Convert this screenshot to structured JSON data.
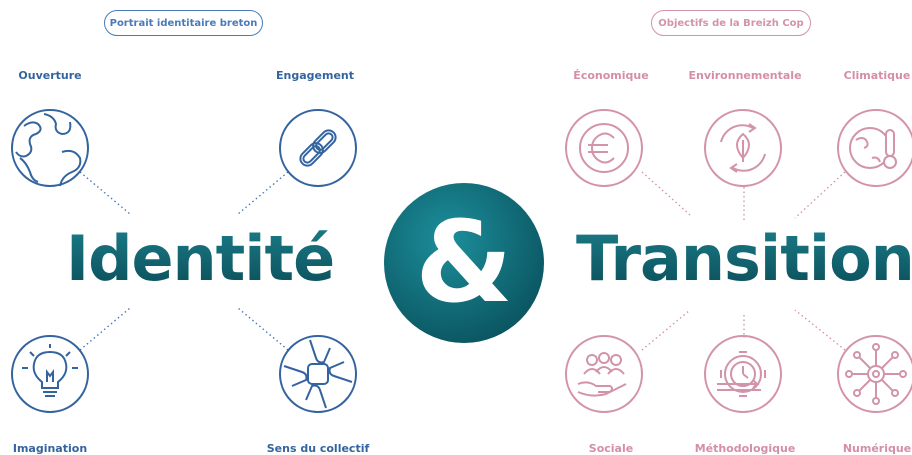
{
  "left_section": {
    "pill": "Portrait identitaire breton",
    "title": "Identité",
    "items": [
      {
        "label": "Ouverture",
        "icon": "globe-icon"
      },
      {
        "label": "Engagement",
        "icon": "chain-link-icon"
      },
      {
        "label": "Imagination",
        "icon": "lightbulb-icon"
      },
      {
        "label": "Sens du collectif",
        "icon": "joined-hands-icon"
      }
    ]
  },
  "center": {
    "symbol": "&"
  },
  "right_section": {
    "pill": "Objectifs de la Breizh Cop",
    "title": "Transitions",
    "items": [
      {
        "label": "Économique",
        "icon": "euro-icon"
      },
      {
        "label": "Environnementale",
        "icon": "leaf-cycle-icon"
      },
      {
        "label": "Climatique",
        "icon": "globe-thermometer-icon"
      },
      {
        "label": "Sociale",
        "icon": "people-hand-icon"
      },
      {
        "label": "Méthodologique",
        "icon": "gear-clock-icon"
      },
      {
        "label": "Numérique",
        "icon": "network-icon"
      }
    ]
  },
  "colors": {
    "blue": "#34649f",
    "pink": "#d48ea6",
    "teal_dark": "#0b5a66",
    "teal_light": "#1a8a96"
  }
}
